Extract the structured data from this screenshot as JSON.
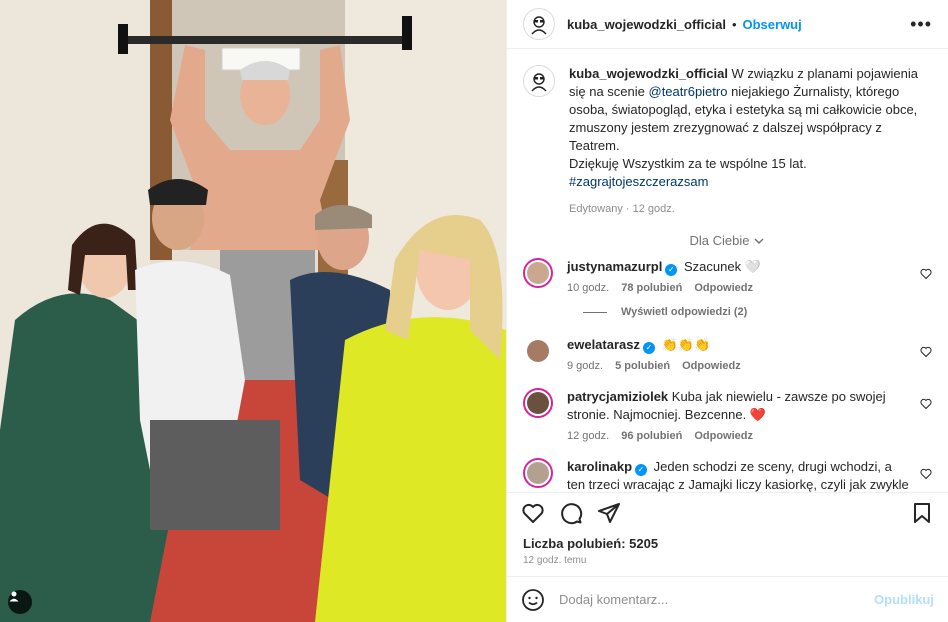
{
  "post": {
    "username": "kuba_wojewodzki_official",
    "follow_label": "Obserwuj",
    "more_label": "•••"
  },
  "caption": {
    "username": "kuba_wojewodzki_official",
    "text_1": " W związku z planami pojawienia się na scenie ",
    "mention": "@teatr6pietro",
    "text_2": " niejakiego Żurnalisty, którego osoba, światopogląd, etyka i estetyka są mi całkowicie obce, zmuszony jestem zrezygnować z dalszej współpracy z Teatrem.",
    "text_3": "Dziękuję Wszystkim za te wspólne 15 lat.",
    "hashtag": "#zagrajtojeszczerazsam",
    "meta": "Edytowany · 12 godz."
  },
  "for_you_label": "Dla Ciebie",
  "comments": [
    {
      "username": "justynamazurpl",
      "verified": true,
      "text": "Szacunek 🤍",
      "time": "10 godz.",
      "likes": "78 polubień",
      "reply": "Odpowiedz",
      "avatar_color": "#c9a88f"
    },
    {
      "username": "ewelatarasz",
      "verified": true,
      "text": "👏👏👏",
      "time": "9 godz.",
      "likes": "5 polubień",
      "reply": "Odpowiedz",
      "avatar_color": "#a57c63"
    },
    {
      "username": "patrycjamiziolek",
      "verified": false,
      "text": "Kuba jak niewielu - zawsze po swojej stronie. Najmocniej. Bezcenne. ❤️",
      "time": "12 godz.",
      "likes": "96 polubień",
      "reply": "Odpowiedz",
      "avatar_color": "#6b5040"
    },
    {
      "username": "karolinakp",
      "verified": true,
      "text": "Jeden schodzi ze sceny, drugi wchodzi, a ten trzeci wracając z Jamajki liczy kasiorkę, czyli jak zwykle 😂",
      "time": "",
      "likes": "",
      "reply": "",
      "avatar_color": "#b3a090"
    }
  ],
  "view_replies_label": "Wyświetl odpowiedzi (2)",
  "likes_label": "Liczba polubień: 5205",
  "time_ago": "12 godz. temu",
  "add_comment": {
    "placeholder": "Dodaj komentarz...",
    "post_label": "Opublikuj"
  },
  "icons": {
    "like": "heart-icon",
    "comment": "comment-icon",
    "share": "share-icon",
    "save": "bookmark-icon",
    "emoji": "emoji-icon",
    "tags": "user-tag-icon"
  },
  "colors": {
    "accent": "#0095f6",
    "link": "#00376b",
    "muted": "#737373",
    "heart_red": "#ed4956"
  }
}
